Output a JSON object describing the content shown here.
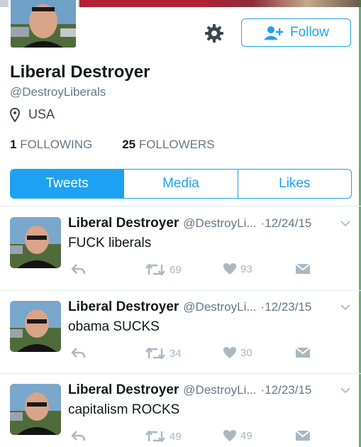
{
  "profile": {
    "name": "Liberal Destroyer",
    "handle": "@DestroyLiberals",
    "location": "USA",
    "following_count": "1",
    "following_label": "FOLLOWING",
    "followers_count": "25",
    "followers_label": "FOLLOWERS",
    "follow_label": "Follow"
  },
  "tabs": [
    {
      "label": "Tweets",
      "active": true
    },
    {
      "label": "Media",
      "active": false
    },
    {
      "label": "Likes",
      "active": false
    }
  ],
  "tweets": [
    {
      "name": "Liberal Destroyer",
      "handle": "@DestroyLi...",
      "date": "·12/24/15",
      "text": "FUCK liberals",
      "retweets": "69",
      "likes": "93"
    },
    {
      "name": "Liberal Destroyer",
      "handle": "@DestroyLi...",
      "date": "·12/23/15",
      "text": "obama SUCKS",
      "retweets": "34",
      "likes": "30"
    },
    {
      "name": "Liberal Destroyer",
      "handle": "@DestroyLi...",
      "date": "·12/23/15",
      "text": "capitalism ROCKS",
      "retweets": "49",
      "likes": "49"
    }
  ],
  "colors": {
    "accent": "#1da1f2",
    "muted": "#657786",
    "action_icon": "#aab8c2",
    "divider": "#e1e8ed"
  },
  "icons": {
    "settings": "gear-icon",
    "follow": "add-user-icon",
    "location": "location-pin-icon",
    "reply": "reply-icon",
    "retweet": "retweet-icon",
    "like": "heart-icon",
    "dm": "direct-message-icon",
    "menu": "chevron-down-icon"
  }
}
